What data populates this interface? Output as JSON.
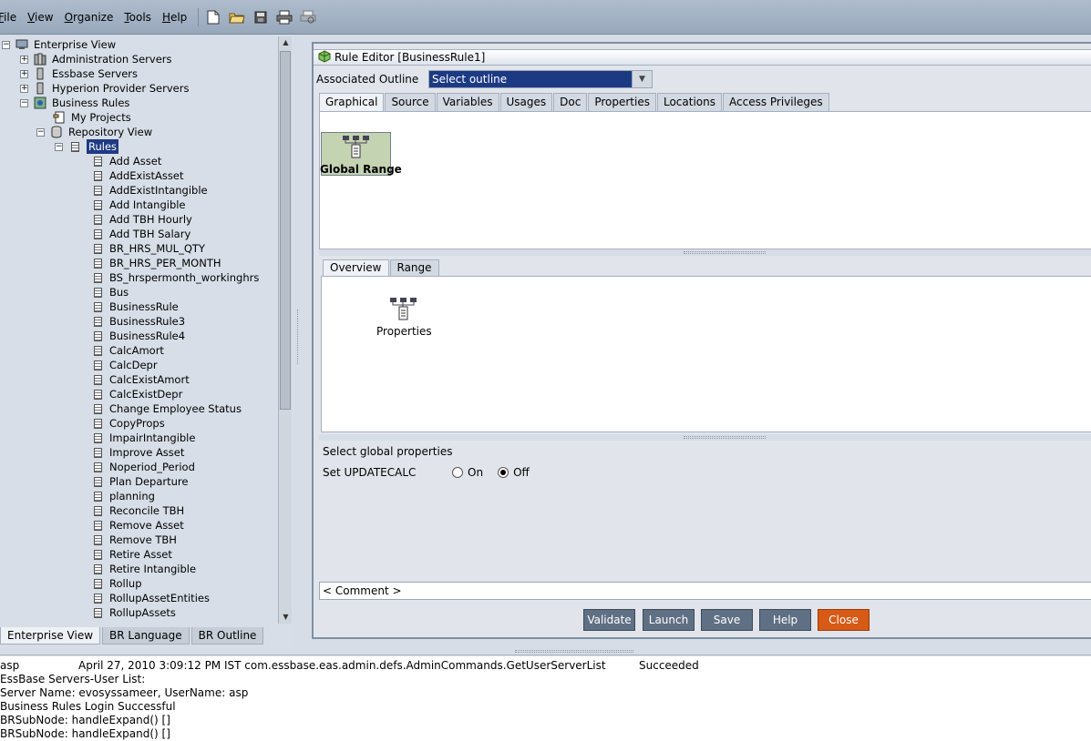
{
  "menubar": {
    "items": [
      "File",
      "View",
      "Organize",
      "Tools",
      "Help"
    ],
    "mnemonics": [
      "F",
      "V",
      "O",
      "T",
      "H"
    ],
    "toolbar_icons": [
      "new-document-icon",
      "open-folder-icon",
      "save-icon",
      "print-icon",
      "print-preview-icon"
    ]
  },
  "tree": {
    "root": "Enterprise View",
    "admin_servers": "Administration Servers",
    "essbase_servers": "Essbase Servers",
    "hyperion_provider": "Hyperion Provider Servers",
    "business_rules": "Business Rules",
    "my_projects": "My Projects",
    "repository_view": "Repository View",
    "rules": "Rules",
    "rule_items": [
      "Add Asset",
      "AddExistAsset",
      "AddExistIntangible",
      "Add Intangible",
      "Add TBH Hourly",
      "Add TBH Salary",
      "BR_HRS_MUL_QTY",
      "BR_HRS_PER_MONTH",
      "BS_hrspermonth_workinghrs",
      "Bus",
      "BusinessRule",
      "BusinessRule3",
      "BusinessRule4",
      "CalcAmort",
      "CalcDepr",
      "CalcExistAmort",
      "CalcExistDepr",
      "Change Employee Status",
      "CopyProps",
      "ImpairIntangible",
      "Improve Asset",
      "Noperiod_Period",
      "Plan Departure",
      "planning",
      "Reconcile TBH",
      "Remove Asset",
      "Remove TBH",
      "Retire Asset",
      "Retire Intangible",
      "Rollup",
      "RollupAssetEntities",
      "RollupAssets"
    ]
  },
  "left_tabs": [
    "Enterprise View",
    "BR Language",
    "BR Outline"
  ],
  "editor": {
    "title": "Rule Editor [BusinessRule1]",
    "assoc_label": "Associated Outline",
    "outline_value": "Select outline",
    "tabs": [
      "Graphical",
      "Source",
      "Variables",
      "Usages",
      "Doc",
      "Properties",
      "Locations",
      "Access Privileges"
    ],
    "node_label": "Global Range",
    "subtabs": [
      "Overview",
      "Range"
    ],
    "properties_label": "Properties",
    "select_global": "Select global properties",
    "set_updatecalc": "Set UPDATECALC",
    "radio_on": "On",
    "radio_off": "Off",
    "radio_selected": "Off",
    "comment": "< Comment >",
    "buttons": [
      "Validate",
      "Launch",
      "Save",
      "Help",
      "Close"
    ]
  },
  "log": {
    "row1_user": "asp",
    "row1_time": "April 27, 2010 3:09:12 PM IST com.essbase.eas.admin.defs.AdminCommands.GetUserServerList",
    "row1_status": "Succeeded",
    "lines": [
      "EssBase Servers-User List:",
      "Server Name: evosyssameer, UserName: asp",
      "Business Rules Login Successful",
      "BRSubNode: handleExpand() []",
      "BRSubNode: handleExpand() []"
    ]
  },
  "colors": {
    "selection": "#1f3a83",
    "button": "#5f6f84",
    "close_button": "#d75a16",
    "node_fill": "#c4d3b2"
  }
}
